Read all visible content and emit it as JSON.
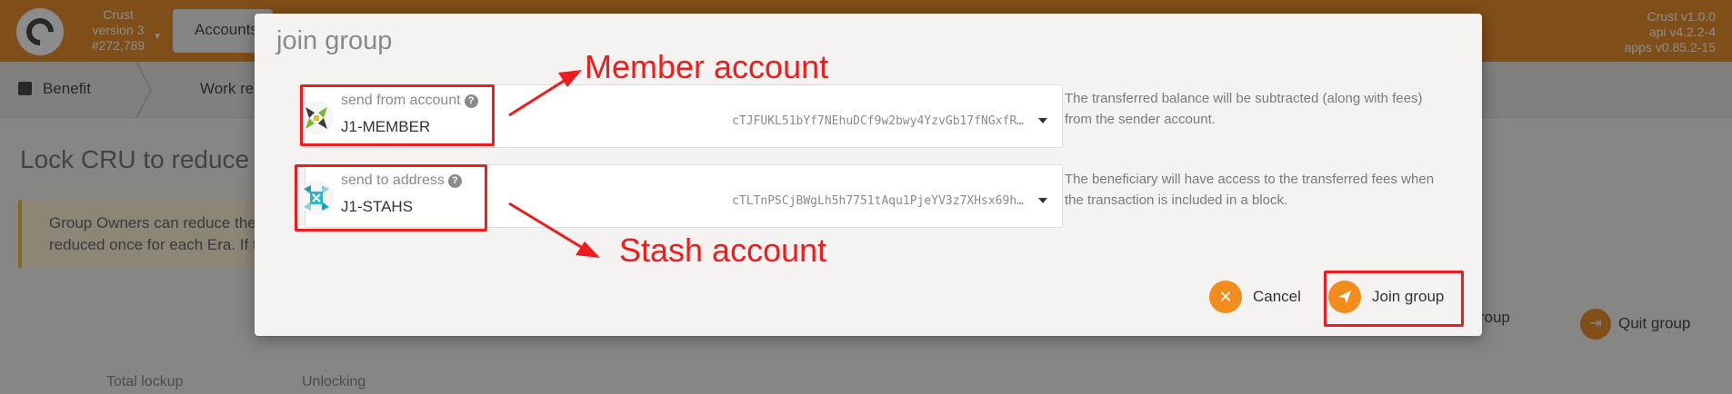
{
  "app": {
    "chain_name": "Crust",
    "chain_version": "version 3",
    "block": "#272,789",
    "nav_tab": "Accounts",
    "version_lines": [
      "Crust v1.0.0",
      "api v4.2.2-4",
      "apps v0.85.2-15"
    ]
  },
  "subnav": {
    "benefit": "Benefit",
    "work": "Work re"
  },
  "background": {
    "page_title": "Lock CRU to reduce t",
    "notice_line1": "Group Owners can reduce the",
    "notice_line2": "reduced once for each Era. If t",
    "btn_join": "oin group",
    "btn_quit": "Quit group",
    "total_lockup": "Total lockup",
    "unlocking": "Unlocking"
  },
  "modal": {
    "title": "join group",
    "from": {
      "label": "send from account",
      "name": "J1-MEMBER",
      "address": "cTJFUKL51bYf7NEhuDCf9w2bwy4YzvGb17fNGxfR…",
      "description": "The transferred balance will be subtracted (along with fees) from the sender account."
    },
    "to": {
      "label": "send to address",
      "name": "J1-STAHS",
      "address": "cTLTnPSCjBWgLh5h7751tAqu1PjeYV3z7XHsx69h…",
      "description": "The beneficiary will have access to the transferred fees when the transaction is included in a block."
    },
    "cancel_label": "Cancel",
    "join_label": "Join group"
  },
  "annotations": {
    "member": "Member account",
    "stash": "Stash account"
  },
  "colors": {
    "accent": "#f28c1c",
    "topbar": "#e98f2c",
    "annotation": "#ee1c1c"
  },
  "icons": {
    "logo": "crust-logo-icon",
    "help": "question-circle-icon",
    "cancel": "close-icon",
    "join": "paper-plane-icon",
    "dropdown": "caret-down-icon"
  }
}
